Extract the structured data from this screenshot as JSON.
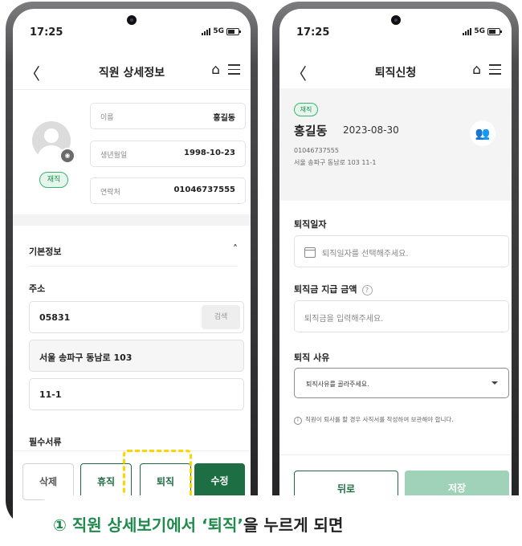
{
  "status": {
    "time": "17:25",
    "network": "5G"
  },
  "screen1": {
    "title": "직원 상세정보",
    "badge": "재직",
    "info": [
      {
        "label": "이름",
        "value": "홍길동"
      },
      {
        "label": "생년월일",
        "value": "1998-10-23"
      },
      {
        "label": "연락처",
        "value": "01046737555"
      }
    ],
    "section_basic": "기본정보",
    "address_label": "주소",
    "postcode": "05831",
    "search_label": "검색",
    "address1": "서울 송파구 동남로 103",
    "address2": "11-1",
    "docs_label": "필수서류",
    "buttons": {
      "delete": "삭제",
      "leave": "휴직",
      "resign": "퇴직",
      "edit": "수정"
    }
  },
  "screen2": {
    "title": "퇴직신청",
    "badge": "재직",
    "name": "홍길동",
    "date": "2023-08-30",
    "phone": "01046737555",
    "address": "서울 송파구 동남로 103 11-1",
    "retire_date_label": "퇴직일자",
    "retire_date_placeholder": "퇴직일자를 선택해주세요.",
    "pay_label": "퇴직금 지급 금액",
    "pay_placeholder": "퇴직금을 입력해주세요.",
    "reason_label": "퇴직 사유",
    "reason_placeholder": "퇴직사유를 골라주세요.",
    "note": "직원이 퇴사를 할 경우 사직서를 작성하여 보관해야 합니다.",
    "buttons": {
      "back": "뒤로",
      "save": "저장"
    }
  },
  "caption": {
    "prefix": "① 직원 상세보기에서 ",
    "highlight": "‘퇴직’",
    "suffix": "을 누르게 되면"
  },
  "colors": {
    "accent": "#1d6e43",
    "highlight": "#ffd400"
  }
}
